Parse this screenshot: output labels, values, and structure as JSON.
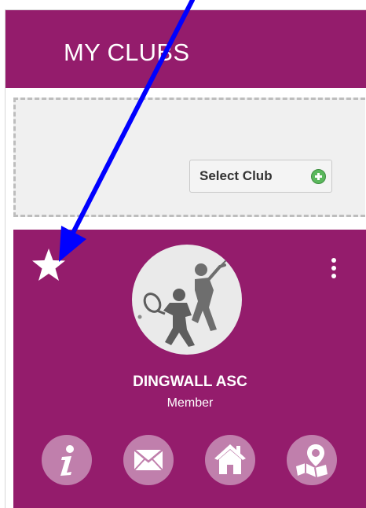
{
  "header": {
    "title": "MY CLUBS"
  },
  "select_club": {
    "label": "Select Club"
  },
  "club_card": {
    "name": "DINGWALL ASC",
    "role": "Member",
    "favorite_icon": "star-icon",
    "menu_icon": "kebab-menu-icon",
    "logo_icon": "tennis-golf-logo",
    "actions": [
      {
        "icon": "info-icon"
      },
      {
        "icon": "mail-icon"
      },
      {
        "icon": "home-icon"
      },
      {
        "icon": "map-pin-icon"
      }
    ]
  },
  "colors": {
    "brand": "#941c6c",
    "action_circle": "#c07fac",
    "plus": "#5bb85d",
    "annotation_arrow": "#0000ff"
  }
}
